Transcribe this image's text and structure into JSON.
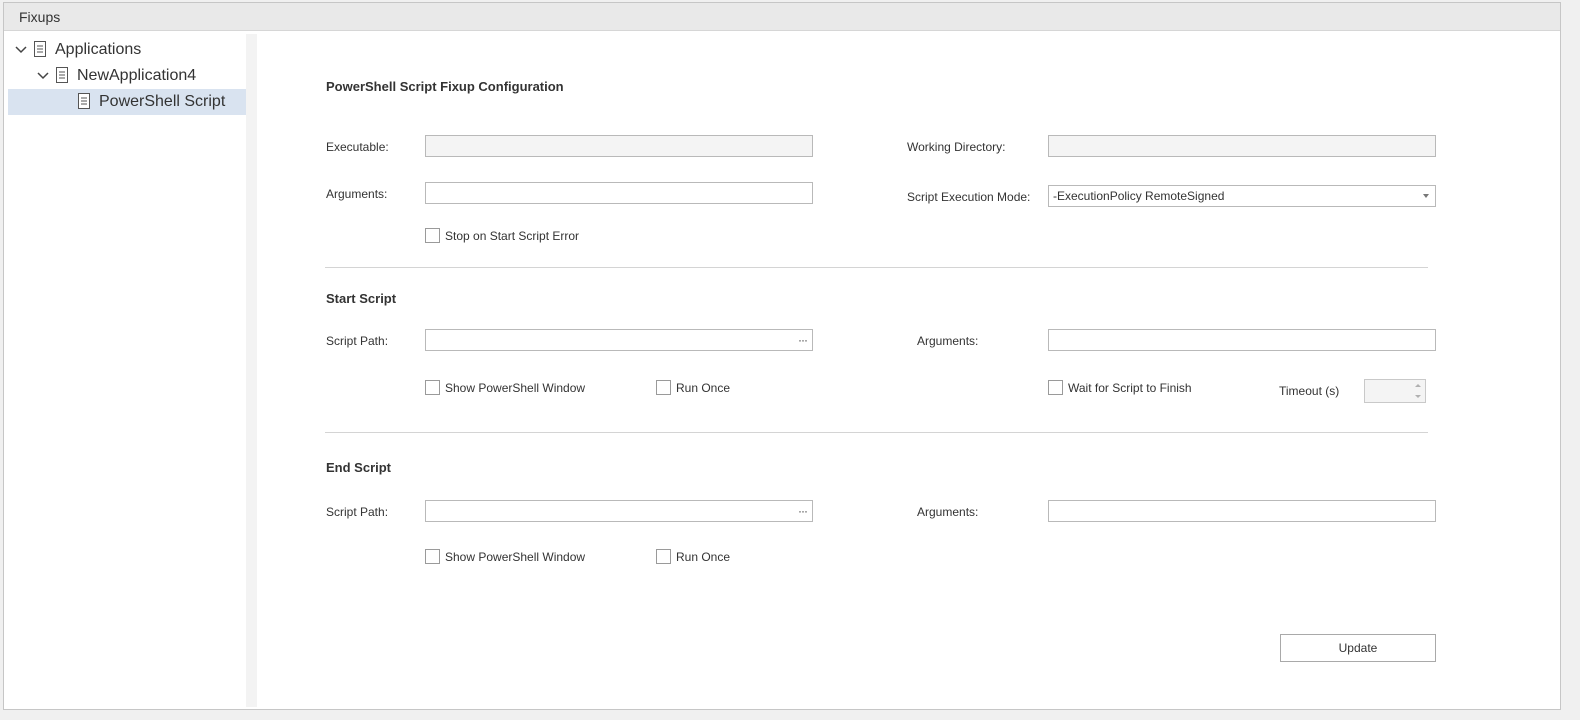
{
  "window": {
    "title": "Fixups"
  },
  "tree": {
    "items": [
      {
        "label": "Applications",
        "expanded": true,
        "level": 0
      },
      {
        "label": "NewApplication4",
        "expanded": true,
        "level": 1
      },
      {
        "label": "PowerShell Script",
        "selected": true,
        "level": 2
      }
    ]
  },
  "config": {
    "title": "PowerShell Script Fixup Configuration",
    "executable_label": "Executable:",
    "executable_value": "",
    "working_directory_label": "Working Directory:",
    "working_directory_value": "",
    "arguments_label": "Arguments:",
    "arguments_value": "",
    "execution_mode_label": "Script Execution Mode:",
    "execution_mode_value": "-ExecutionPolicy RemoteSigned",
    "stop_on_error_label": "Stop on Start Script Error",
    "stop_on_error_checked": false
  },
  "start_script": {
    "title": "Start Script",
    "script_path_label": "Script Path:",
    "script_path_value": "",
    "browse_glyph": "···",
    "arguments_label": "Arguments:",
    "arguments_value": "",
    "show_window_label": "Show PowerShell Window",
    "run_once_label": "Run Once",
    "wait_label": "Wait for Script to Finish",
    "timeout_label": "Timeout (s)",
    "timeout_value": ""
  },
  "end_script": {
    "title": "End Script",
    "script_path_label": "Script Path:",
    "script_path_value": "",
    "browse_glyph": "···",
    "arguments_label": "Arguments:",
    "arguments_value": "",
    "show_window_label": "Show PowerShell Window",
    "run_once_label": "Run Once"
  },
  "actions": {
    "update_label": "Update"
  },
  "icons": {
    "tree_expanded": "chevron-down-icon",
    "tree_node": "document-icon",
    "browse": "ellipsis-icon",
    "dropdown": "caret-down-icon"
  }
}
